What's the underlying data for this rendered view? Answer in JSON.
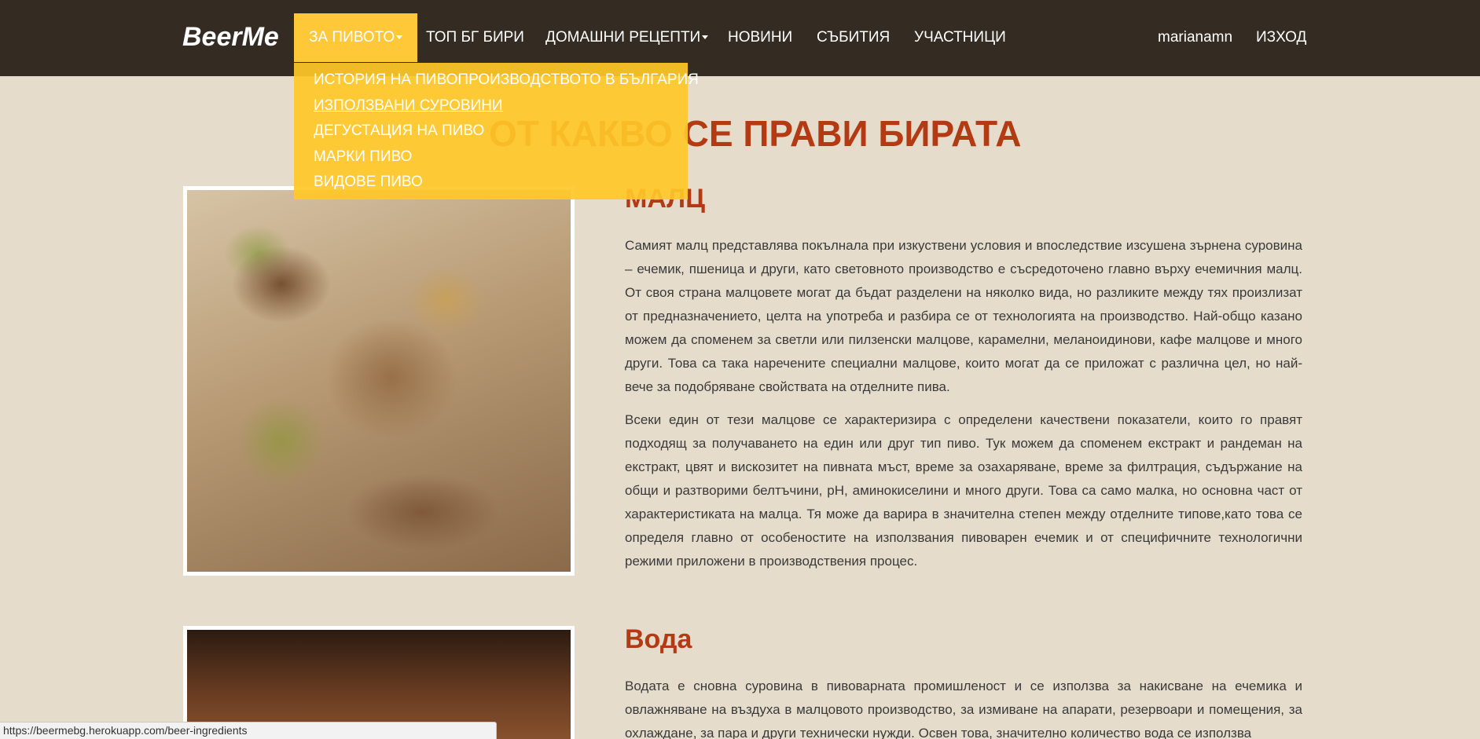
{
  "navbar": {
    "brand": "BeerMe",
    "items": [
      {
        "label": "ЗА ПИВОТО",
        "dropdown": true,
        "active": true
      },
      {
        "label": "ТОП БГ БИРИ"
      },
      {
        "label": "ДОМАШНИ РЕЦЕПТИ",
        "dropdown": true
      },
      {
        "label": "НОВИНИ"
      },
      {
        "label": "СЪБИТИЯ"
      },
      {
        "label": "УЧАСТНИЦИ"
      }
    ],
    "user": "marianamn",
    "logout": "ИЗХОД"
  },
  "dropdown": {
    "items": [
      {
        "label": "ИСТОРИЯ НА ПИВОПРОИЗВОДСТВОТО В БЪЛГАРИЯ"
      },
      {
        "label": "ИЗПОЛЗВАНИ СУРОВИНИ",
        "hovered": true
      },
      {
        "label": "ДЕГУСТАЦИЯ НА ПИВО"
      },
      {
        "label": "МАРКИ ПИВО"
      },
      {
        "label": "ВИДОВЕ ПИВО"
      }
    ]
  },
  "main": {
    "title": "ОТ КАКВО СЕ ПРАВИ БИРАТА",
    "sections": [
      {
        "heading": "МАЛЦ",
        "paragraphs": [
          "Самият малц представлява покълнала при изкуствени условия и впоследствие изсушена зърнена суровина – ечемик, пшеница и други, като световното производство е съсредоточено главно върху ечемичния малц. От своя страна малцовете могат да бъдат разделени на няколко вида, но разликите между тях произлизат от предназначението, целта на употреба и разбира се от технологията на производство. Най-общо казано можем да споменем за светли или пилзенски малцове, карамелни, меланоидинови, кафе малцове и много други. Това са така наречените специални малцове, които могат да се приложат с различна цел, но най-вече за подобряване свойствата на отделните пива.",
          "Всеки един от тези малцове се характеризира с определени качествени показатели, които го правят подходящ за получаването на един или друг тип пиво. Тук можем да споменем екстракт и рандеман на екстракт, цвят и вискозитет на пивната мъст, време за озахаряване, време за филтрация, съдържание на общи и разтворими белтъчини, pH, аминокиселини и много други. Това са само малка, но основна част от характеристиката на малца. Тя може да варира в значителна степен между отделните типове,като това се определя главно от особеностите на използвания пивоварен ечемик и от специфичните технологични режими приложени в производствения процес."
        ]
      },
      {
        "heading": "Вода",
        "paragraphs": [
          "Водата е сновна суровина в пивоварната промишленост и се използва за накисване на ечемика и овлажняване на въздуха в малцовото производство, за измиване на апарати, резервоари и помещения, за охлаждане, за пара и други технически нужди. Освен това, значително количество вода се използва"
        ]
      }
    ]
  },
  "statusbar": {
    "url": "https://beermebg.herokuapp.com/beer-ingredients"
  }
}
